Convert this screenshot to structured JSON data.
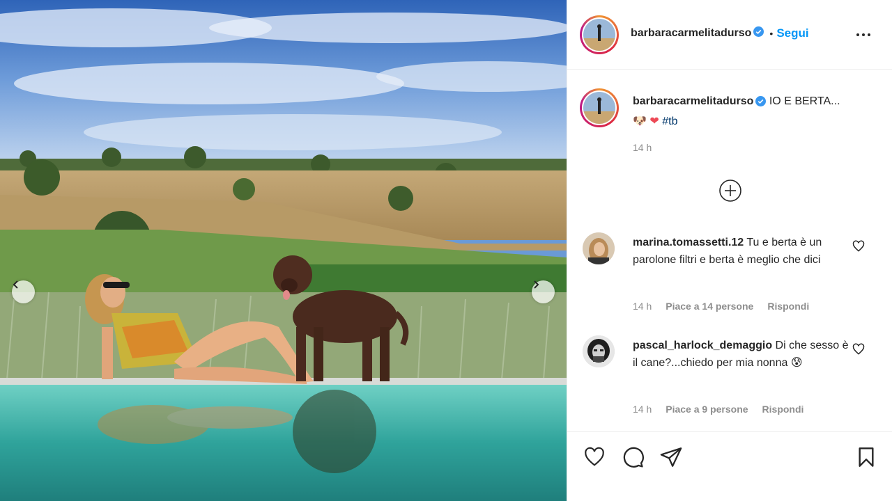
{
  "post": {
    "author": "barbaracarmelitadurso",
    "separator": "•",
    "follow_label": "Segui",
    "caption": {
      "text": "IO E BERTA...",
      "emoji_1": "🐶",
      "emoji_2": "❤",
      "hashtag": "#tb",
      "time": "14 h"
    }
  },
  "comments": [
    {
      "user": "marina.tomassetti.12",
      "text": "Tu e berta è un parolone filtri e berta è meglio che dici",
      "time": "14 h",
      "likes": "Piace a 14 persone",
      "reply": "Rispondi"
    },
    {
      "user": "pascal_harlock_demaggio",
      "text": "Di che sesso è il cane?...chiedo per mia nonna",
      "emoji": "😰",
      "time": "14 h",
      "likes": "Piace a 9 persone",
      "reply": "Rispondi"
    }
  ],
  "icons": {
    "verified": "verified-badge-icon",
    "more": "more-options-icon",
    "load_more": "plus-circle-icon",
    "like": "heart-icon",
    "comment": "comment-icon",
    "share": "share-icon",
    "save": "bookmark-icon",
    "prev": "chevron-left-icon",
    "next": "chevron-right-icon"
  },
  "colors": {
    "accent": "#0095f6",
    "text": "#262626",
    "muted": "#8e8e8e",
    "heart": "#ed4956",
    "hashtag": "#00376b"
  }
}
